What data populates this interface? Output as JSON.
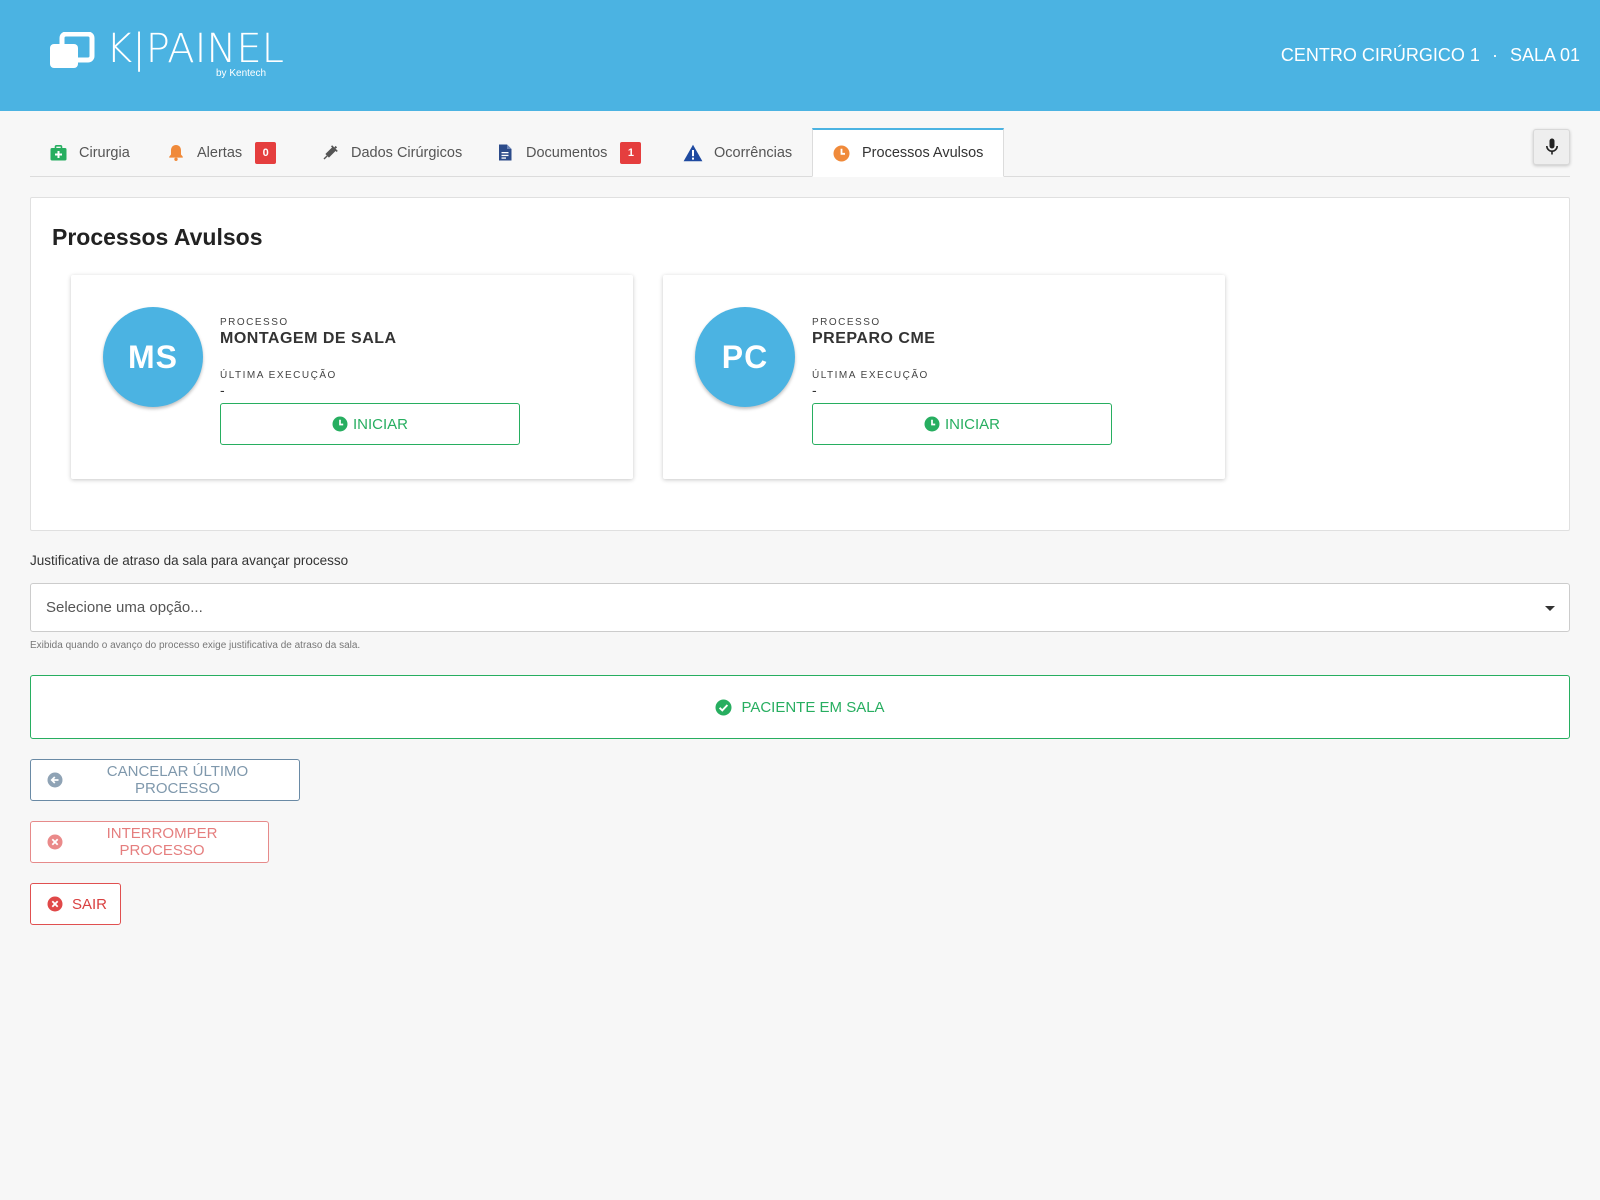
{
  "header": {
    "logo_text": "K|PAINEL",
    "logo_subtext": "by Kentech",
    "center": "CENTRO CIRÚRGICO 1",
    "separator": "·",
    "room": "SALA 01",
    "color": "#4bb3e2"
  },
  "tabs": [
    {
      "label": "Cirurgia",
      "icon": "first-aid-kit-icon"
    },
    {
      "label": "Alertas",
      "icon": "bell-icon",
      "badge": "0"
    },
    {
      "label": "Dados Cirúrgicos",
      "icon": "syringe-icon"
    },
    {
      "label": "Documentos",
      "icon": "document-icon",
      "badge": "1"
    },
    {
      "label": "Ocorrências",
      "icon": "warning-icon"
    },
    {
      "label": "Processos Avulsos",
      "icon": "clock-icon",
      "active": true
    }
  ],
  "mic": {
    "icon": "microphone-icon"
  },
  "panel": {
    "title": "Processos Avulsos",
    "cards": [
      {
        "initials": "MS",
        "process_label": "PROCESSO",
        "process_name": "MONTAGEM DE SALA",
        "last_exec_label": "ÚLTIMA EXECUÇÃO",
        "last_exec_value": "-",
        "button_label": "INICIAR"
      },
      {
        "initials": "PC",
        "process_label": "PROCESSO",
        "process_name": "PREPARO CME",
        "last_exec_label": "ÚLTIMA EXECUÇÃO",
        "last_exec_value": "-",
        "button_label": "INICIAR"
      }
    ]
  },
  "justification": {
    "label": "Justificativa de atraso da sala para avançar processo",
    "placeholder": "Selecione uma opção...",
    "hint": "Exibida quando o avanço do processo exige justificativa de atraso da sala."
  },
  "actions": {
    "patient_in_room": "PACIENTE EM SALA",
    "cancel_last": "CANCELAR ÚLTIMO PROCESSO",
    "interrupt": "INTERROMPER PROCESSO",
    "exit": "SAIR"
  },
  "colors": {
    "accent": "#4bb3e2",
    "success": "#27ae60",
    "danger": "#e53e3e",
    "muted_blue": "#7f98ac"
  }
}
